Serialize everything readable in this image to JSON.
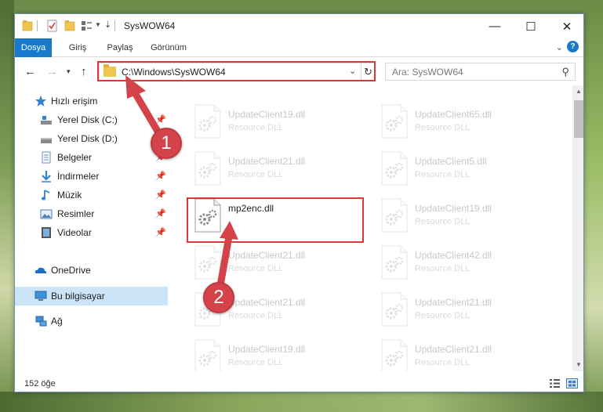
{
  "window": {
    "title": "SysWOW64",
    "controls": {
      "minimize": "—",
      "maximize": "☐",
      "close": "✕"
    }
  },
  "ribbon": {
    "tabs": [
      "Dosya",
      "Giriş",
      "Paylaş",
      "Görünüm"
    ],
    "help": "?"
  },
  "navigation": {
    "address": "C:\\Windows\\SysWOW64",
    "search_placeholder": "Ara: SysWOW64"
  },
  "sidebar": {
    "items": [
      {
        "label": "Hızlı erişim",
        "icon": "star-icon",
        "pinned": false
      },
      {
        "label": "Yerel Disk (C:)",
        "icon": "drive-icon",
        "pinned": true
      },
      {
        "label": "Yerel Disk (D:)",
        "icon": "drive-icon",
        "pinned": true
      },
      {
        "label": "Belgeler",
        "icon": "documents-icon",
        "pinned": true
      },
      {
        "label": "İndirmeler",
        "icon": "download-icon",
        "pinned": true
      },
      {
        "label": "Müzik",
        "icon": "music-icon",
        "pinned": true
      },
      {
        "label": "Resimler",
        "icon": "pictures-icon",
        "pinned": true
      },
      {
        "label": "Videolar",
        "icon": "videos-icon",
        "pinned": true
      },
      {
        "label": "OneDrive",
        "icon": "cloud-icon",
        "pinned": false
      },
      {
        "label": "Bu bilgisayar",
        "icon": "computer-icon",
        "pinned": false,
        "selected": true
      },
      {
        "label": "Ağ",
        "icon": "network-icon",
        "pinned": false
      }
    ]
  },
  "files": [
    {
      "name": "UpdateClient19.dll",
      "type": "Resource DLL"
    },
    {
      "name": "UpdateClient65.dll",
      "type": "Resource DLL"
    },
    {
      "name": "UpdateClient21.dll",
      "type": "Resource DLL"
    },
    {
      "name": "UpdateClient5.dll",
      "type": "Resource DLL"
    },
    {
      "name": "mp2enc.dll",
      "type": "",
      "highlighted": true
    },
    {
      "name": "UpdateClient19.dll",
      "type": "Resource DLL"
    },
    {
      "name": "UpdateClient21.dll",
      "type": "Resource DLL"
    },
    {
      "name": "UpdateClient42.dll",
      "type": "Resource DLL"
    },
    {
      "name": "UpdateClient21.dll",
      "type": "Resource DLL"
    },
    {
      "name": "UpdateClient21.dll",
      "type": "Resource DLL"
    },
    {
      "name": "UpdateClient19.dll",
      "type": "Resource DLL"
    },
    {
      "name": "UpdateClient21.dll",
      "type": "Resource DLL"
    }
  ],
  "status": {
    "item_count": "152 öğe"
  },
  "callouts": [
    "1",
    "2"
  ],
  "colors": {
    "accent": "#1979ca",
    "highlight": "#d9393a",
    "callout": "#d4434a"
  }
}
